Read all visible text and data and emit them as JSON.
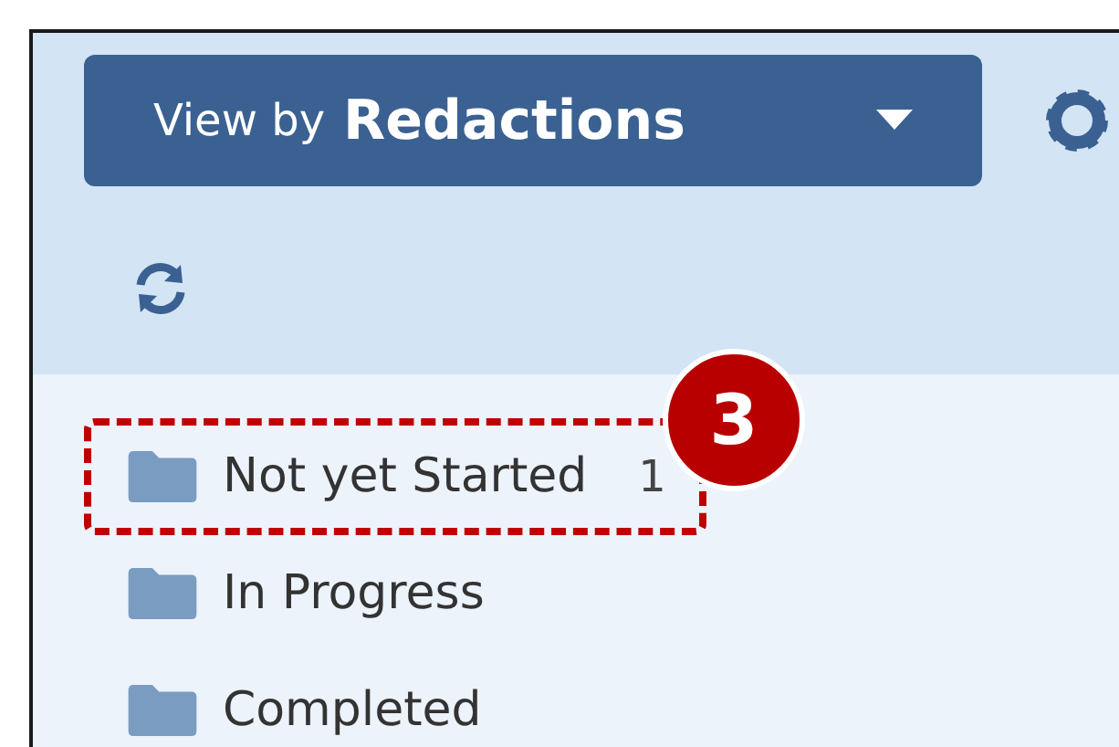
{
  "view_button": {
    "prefix": "View by",
    "value": "Redactions"
  },
  "folders": [
    {
      "label": "Not yet Started",
      "count": "1",
      "highlighted": true
    },
    {
      "label": "In Progress",
      "highlighted": false
    },
    {
      "label": "Completed",
      "highlighted": false
    }
  ],
  "callout": {
    "number": "3"
  }
}
